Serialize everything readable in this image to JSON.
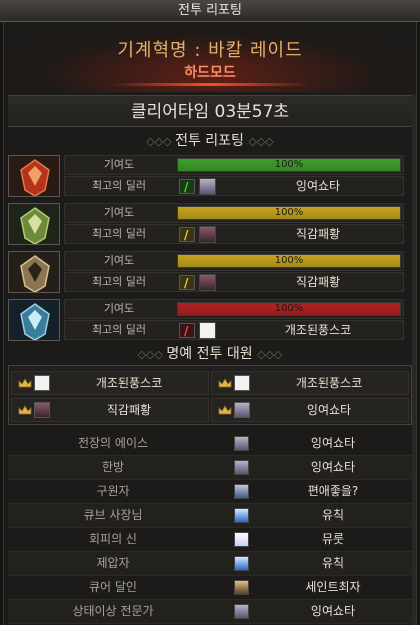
{
  "window": {
    "title": "전투 리포팅"
  },
  "raid": {
    "name": "기계혁명 : 바칼 레이드",
    "mode": "하드모드"
  },
  "clear_time": {
    "text": "클리어타임   03분57초"
  },
  "report_section": {
    "title": "전투 리포팅"
  },
  "boss_reports": [
    {
      "contribution_label": "기여도",
      "contribution_text": "100%",
      "contribution_value": 1.0,
      "bar_color": "#3ea02c",
      "dealer_label": "최고의 딜러",
      "dealer_name": "잉여쇼타",
      "class_color": "#2fb52a",
      "boss_color": "#b5331d"
    },
    {
      "contribution_label": "기여도",
      "contribution_text": "100%",
      "contribution_value": 1.0,
      "bar_color": "#c8a41c",
      "dealer_label": "최고의 딜러",
      "dealer_name": "직감패황",
      "class_color": "#e3c51c",
      "boss_color": "#6b8a3a"
    },
    {
      "contribution_label": "기여도",
      "contribution_text": "100%",
      "contribution_value": 1.0,
      "bar_color": "#c8a41c",
      "dealer_label": "최고의 딜러",
      "dealer_name": "직감패황",
      "class_color": "#e3c51c",
      "boss_color": "#8a7652"
    },
    {
      "contribution_label": "기여도",
      "contribution_text": "100%",
      "contribution_value": 1.0,
      "bar_color": "#b42222",
      "dealer_label": "최고의 딜러",
      "dealer_name": "개조된풍스코",
      "class_color": "#d52a2a",
      "boss_color": "#3b7c9a"
    }
  ],
  "honor_section": {
    "title": "명예 전투 대원",
    "members": [
      "개조된풍스코",
      "개조된풍스코",
      "직감패황",
      "잉여쇼타"
    ]
  },
  "titles": [
    {
      "label": "전장의 에이스",
      "name": "잉여쇼타"
    },
    {
      "label": "한방",
      "name": "잉여쇼타"
    },
    {
      "label": "구원자",
      "name": "편애좋을?"
    },
    {
      "label": "큐브 사장님",
      "name": "유칙"
    },
    {
      "label": "회피의 신",
      "name": "뮤룻"
    },
    {
      "label": "제압자",
      "name": "유칙"
    },
    {
      "label": "큐어 달인",
      "name": "세인트최자"
    },
    {
      "label": "상태이상 전문가",
      "name": "잉여쇼타"
    }
  ]
}
